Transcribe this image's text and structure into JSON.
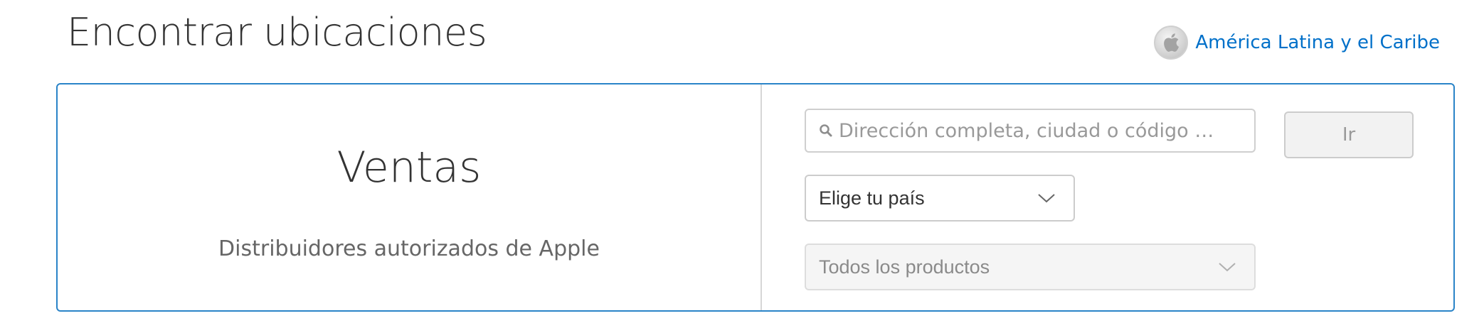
{
  "header": {
    "title": "Encontrar ubicaciones",
    "region_label": "América Latina y el Caribe",
    "region_icon": "apple-globe-icon"
  },
  "panel": {
    "left": {
      "title": "Ventas",
      "subtitle": "Distribuidores autorizados de Apple"
    },
    "right": {
      "search": {
        "value": "",
        "placeholder": "Dirección completa, ciudad o código …",
        "icon": "search-icon"
      },
      "go_button_label": "Ir",
      "country_select": {
        "selected": "Elige tu país",
        "icon": "chevron-down-icon"
      },
      "products_select": {
        "selected": "Todos los productos",
        "icon": "chevron-down-icon",
        "disabled": true
      }
    }
  },
  "colors": {
    "accent": "#0070c9",
    "panel_border": "#2a84c8",
    "text_primary": "#333333",
    "text_secondary": "#666666",
    "placeholder": "#999999"
  }
}
